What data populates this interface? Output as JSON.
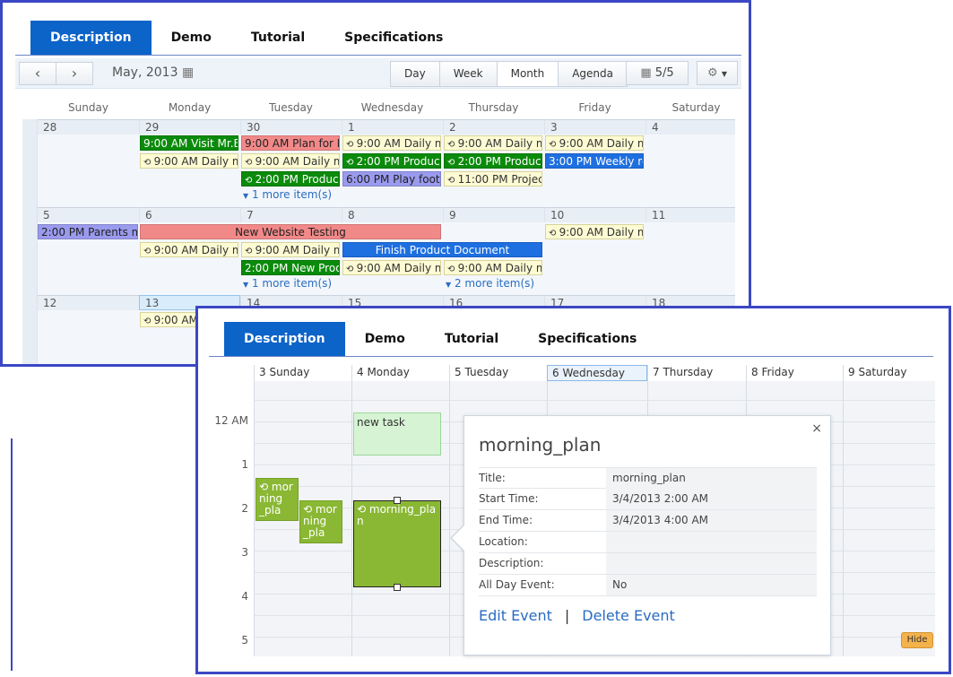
{
  "tabs": [
    "Description",
    "Demo",
    "Tutorial",
    "Specifications"
  ],
  "month": {
    "title": "May, 2013",
    "views": [
      "Day",
      "Week",
      "Month",
      "Agenda"
    ],
    "active_view": "Month",
    "page_indicator": "5/5",
    "day_names": [
      "Sunday",
      "Monday",
      "Tuesday",
      "Wednesday",
      "Thursday",
      "Friday",
      "Saturday"
    ],
    "week1_dates": [
      "28",
      "29",
      "30",
      "1",
      "2",
      "3",
      "4"
    ],
    "week2_dates": [
      "5",
      "6",
      "7",
      "8",
      "9",
      "10",
      "11"
    ],
    "week3_dates": [
      "12",
      "13",
      "14",
      "15",
      "16",
      "17",
      "18"
    ],
    "events": {
      "visit": "9:00 AM Visit Mr.Br",
      "plan": "9:00 AM Plan for It",
      "daily": "9:00 AM Daily m",
      "product": "2:00 PM Produc",
      "product_wed": "2:00 PM Product",
      "play": "6:00 PM Play footb",
      "project": "11:00 PM Projec",
      "weekly": "3:00 PM Weekly re",
      "parents": "2:00 PM Parents m",
      "website": "New Website Testing",
      "new_product": "2:00 PM New Produ",
      "finish": "Finish Product Document",
      "nine_am": "9:00 AM"
    },
    "more1": "1 more item(s)",
    "more2": "2 more item(s)"
  },
  "week": {
    "headers": [
      "3 Sunday",
      "4 Monday",
      "5 Tuesday",
      "6 Wednesday",
      "7 Thursday",
      "8 Friday",
      "9 Saturday"
    ],
    "times": [
      "12 AM",
      "1",
      "2",
      "3",
      "4",
      "5"
    ],
    "new_task": "new task",
    "morning_a": "mor ning _pla",
    "morning_b": "mor ning _pla",
    "morning_main": "morning_pla n"
  },
  "popup": {
    "title": "morning_plan",
    "rows": [
      {
        "label": "Title:",
        "value": "morning_plan"
      },
      {
        "label": "Start Time:",
        "value": "3/4/2013 2:00 AM"
      },
      {
        "label": "End Time:",
        "value": "3/4/2013 4:00 AM"
      },
      {
        "label": "Location:",
        "value": ""
      },
      {
        "label": "Description:",
        "value": ""
      },
      {
        "label": "All Day Event:",
        "value": "No"
      }
    ],
    "edit": "Edit Event",
    "separator": "|",
    "delete": "Delete Event",
    "close": "×"
  },
  "hide_label": "Hide",
  "colors": {
    "accent": "#0c63c8",
    "frame": "#3b47c4",
    "event_green": "#0b8a0b",
    "plan_green": "#8ab834"
  }
}
